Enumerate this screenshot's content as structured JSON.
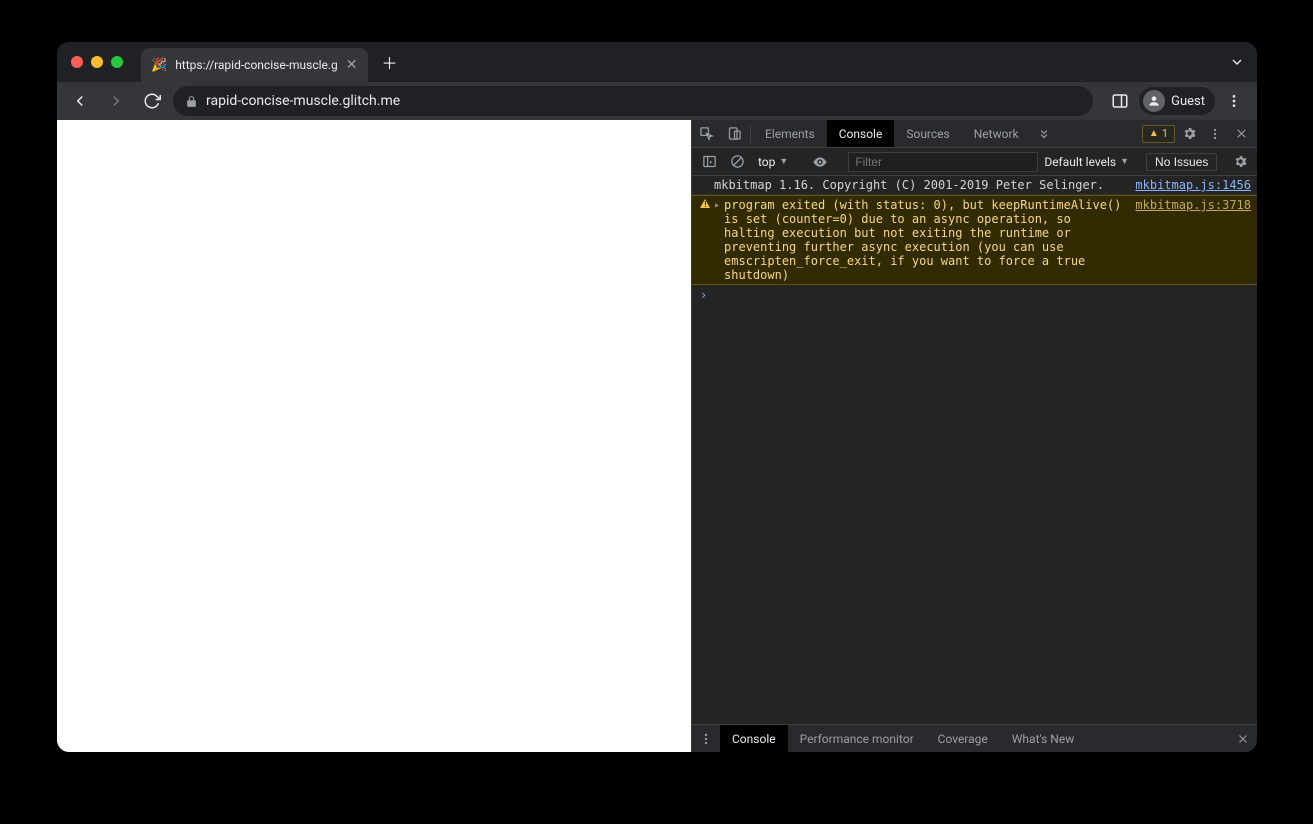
{
  "tab": {
    "favicon": "🎉",
    "title": "https://rapid-concise-muscle.g"
  },
  "toolbar": {
    "url": "rapid-concise-muscle.glitch.me",
    "profile_label": "Guest"
  },
  "devtools": {
    "tabs": {
      "elements": "Elements",
      "console": "Console",
      "sources": "Sources",
      "network": "Network"
    },
    "warn_count": "1",
    "console_toolbar": {
      "context": "top",
      "filter_placeholder": "Filter",
      "levels_label": "Default levels",
      "issues_label": "No Issues"
    },
    "messages": [
      {
        "type": "log",
        "text": "mkbitmap 1.16. Copyright (C) 2001-2019 Peter Selinger.",
        "src": "mkbitmap.js:1456"
      },
      {
        "type": "warn",
        "text": "program exited (with status: 0), but keepRuntimeAlive() is set (counter=0) due to an async operation, so halting execution but not exiting the runtime or preventing further async execution (you can use emscripten_force_exit, if you want to force a true shutdown)",
        "src": "mkbitmap.js:3718"
      }
    ],
    "drawer": {
      "console": "Console",
      "perf": "Performance monitor",
      "coverage": "Coverage",
      "whatsnew": "What's New"
    }
  }
}
